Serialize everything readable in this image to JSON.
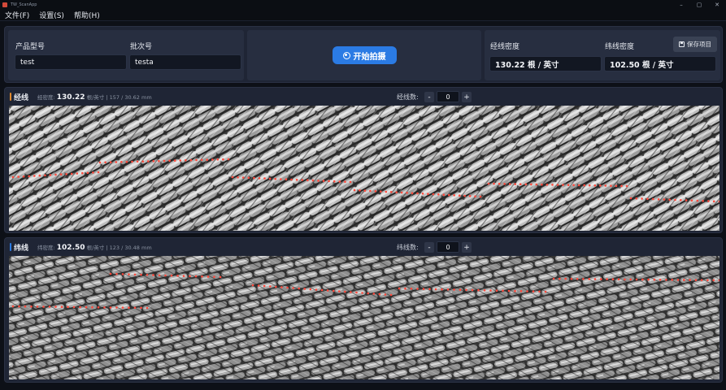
{
  "window": {
    "title": "TW_ScanApp",
    "controls": [
      "–",
      "▢",
      "✕"
    ]
  },
  "menu": [
    "文件(F)",
    "设置(S)",
    "帮助(H)"
  ],
  "product": {
    "model_label": "产品型号",
    "model_value": "test",
    "batch_label": "批次号",
    "batch_value": "testa"
  },
  "capture": {
    "start_label": "开始拍摄"
  },
  "density": {
    "warp_label": "经线密度",
    "warp_value": "130.22 根 / 英寸",
    "weft_label": "纬线密度",
    "weft_value": "102.50 根 / 英寸",
    "save_label": "保存项目"
  },
  "warp_panel": {
    "title": "经线",
    "density_prefix": "经密度:",
    "density_value": "130.22",
    "density_suffix": "根/英寸 | 157 / 30.62 mm",
    "count_label": "经线数:",
    "count_value": "0",
    "minus": "-",
    "plus": "+",
    "accent_color": "#e08a2e"
  },
  "weft_panel": {
    "title": "纬线",
    "density_prefix": "纬密度:",
    "density_value": "102.50",
    "density_suffix": "根/英寸 | 123 / 30.48 mm",
    "count_label": "纬线数:",
    "count_value": "0",
    "minus": "-",
    "plus": "+",
    "accent_color": "#2b7be4"
  },
  "icons": {
    "camera": "camera-icon",
    "save": "save-icon",
    "app": "app-icon"
  }
}
